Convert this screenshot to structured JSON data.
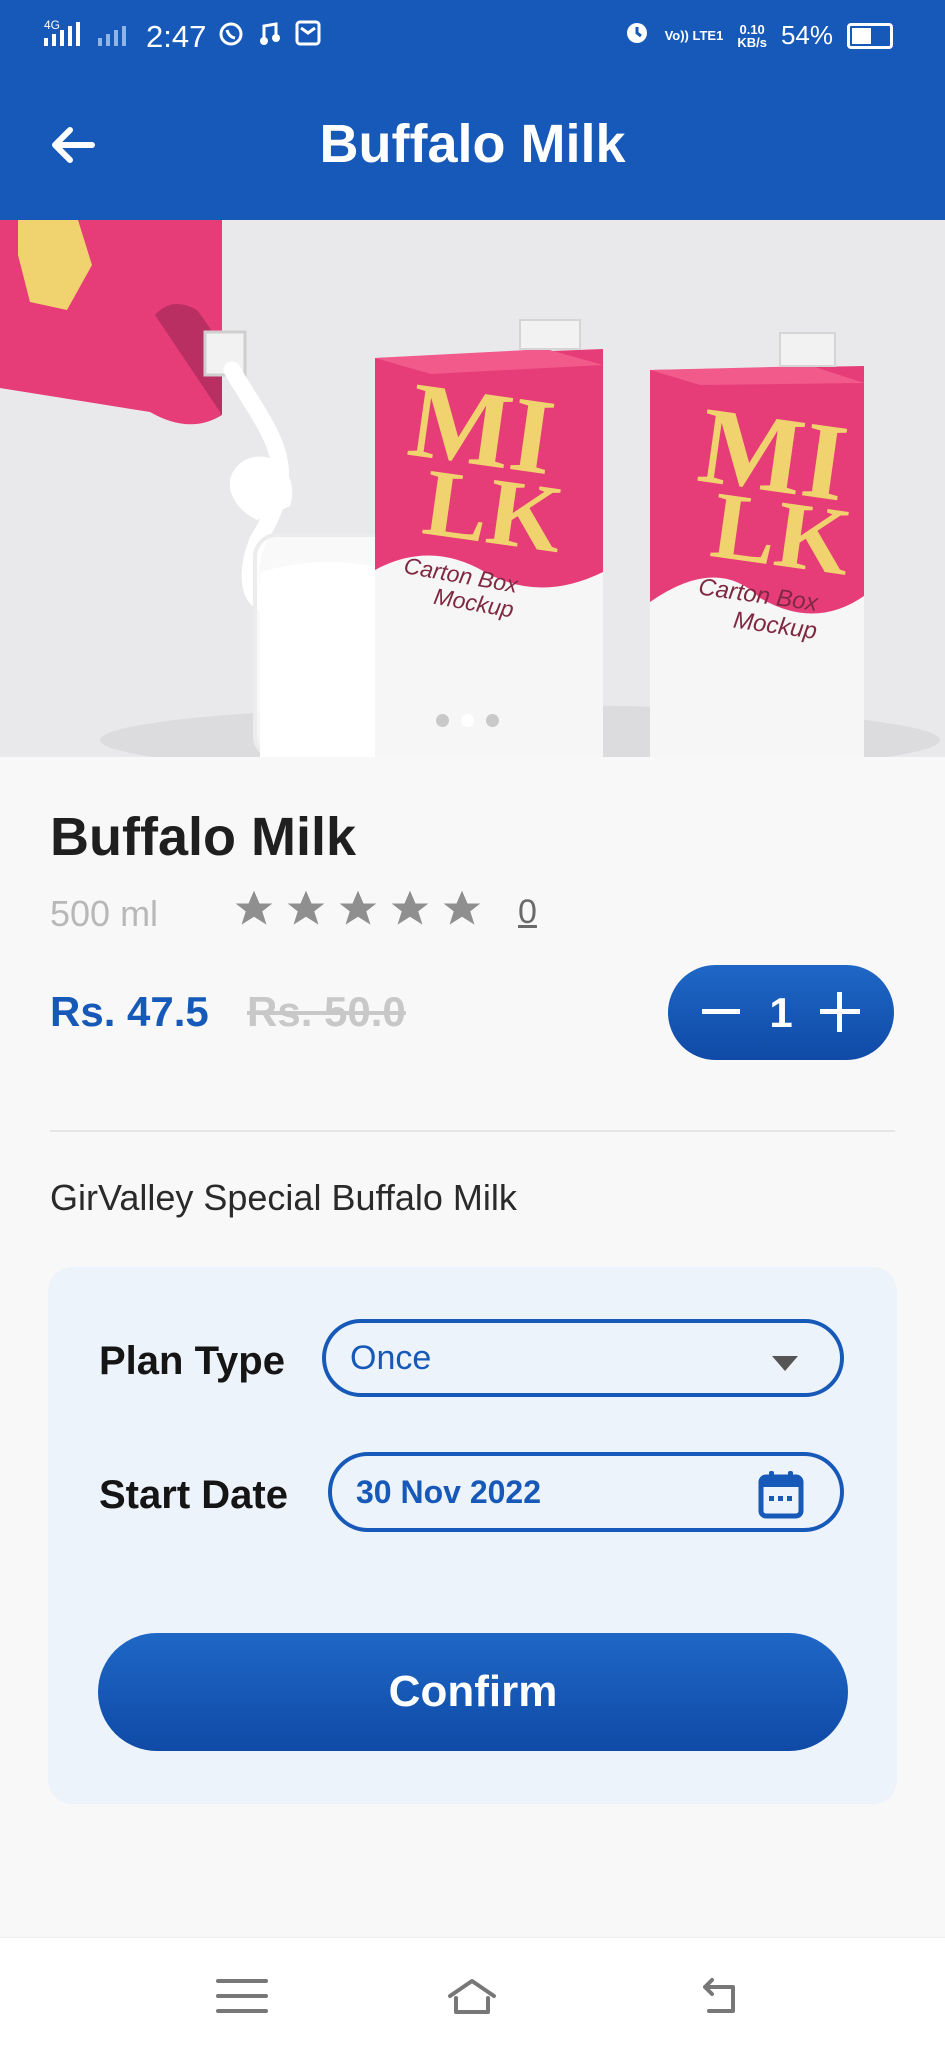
{
  "status_bar": {
    "network": "4G",
    "time": "2:47",
    "volte": "Vo)) LTE1",
    "speed_value": "0.10",
    "speed_unit": "KB/s",
    "battery": "54%",
    "battery_level": 0.54,
    "icons": [
      "signal-icon",
      "signal-weak-icon",
      "whatsapp-icon",
      "music-icon",
      "message-icon",
      "alarm-icon"
    ]
  },
  "app_bar": {
    "title": "Buffalo Milk",
    "back_icon": "back-arrow-icon"
  },
  "carousel": {
    "image_name": "milk-carton-product-image",
    "printed_text": "MILK Carton Box Mockup",
    "active_dot": 2,
    "dot_count": 3
  },
  "product": {
    "name": "Buffalo Milk",
    "volume": "500 ml",
    "rating_stars": 5,
    "rating_count": "0",
    "price": "Rs. 47.5",
    "old_price": "Rs. 50.0",
    "quantity": "1",
    "description": "GirValley Special Buffalo Milk"
  },
  "subscription": {
    "plan_label": "Plan Type",
    "plan_value": "Once",
    "start_label": "Start Date",
    "start_value": "30 Nov 2022",
    "confirm_label": "Confirm"
  },
  "navigation": {
    "menu_icon": "menu-icon",
    "home_icon": "home-icon",
    "back_icon": "back-icon"
  },
  "colors": {
    "primary": "#1759b8",
    "accent_gradient_start": "#1f67c6",
    "accent_gradient_end": "#0f4aa6",
    "card_background": "#edf3fb",
    "muted_text": "#b8b8b8",
    "carton_pink": "#e63d78",
    "milk_yellow": "#f0d36e"
  }
}
